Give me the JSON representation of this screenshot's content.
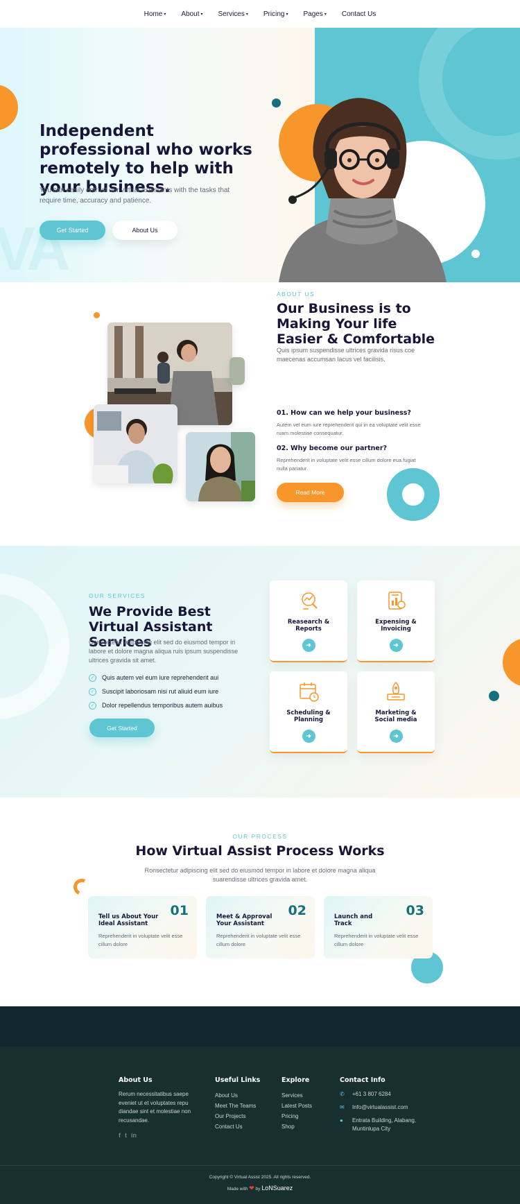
{
  "nav": {
    "items": [
      {
        "label": "Home",
        "dropdown": true
      },
      {
        "label": "About",
        "dropdown": true
      },
      {
        "label": "Services",
        "dropdown": true
      },
      {
        "label": "Pricing",
        "dropdown": true
      },
      {
        "label": "Pages",
        "dropdown": true
      },
      {
        "label": "Contact Us",
        "dropdown": false
      }
    ],
    "caret": "▾"
  },
  "hero": {
    "title": "Independent professional who works remotely to help with your business.",
    "text": "You can easily entrust our virtual assistants with the tasks that require time, accuracy and patience.",
    "primary_button": "Get Started",
    "secondary_button": "About Us"
  },
  "about": {
    "eyebrow": "ABOUT US",
    "title": "Our Business is to Making Your life Easier & Comfortable",
    "text": "Quis ipsum suspendisse ultrices gravida risus coe maecenas accumsan lacus vel facilisis.",
    "q1": "01. How can we help your business?",
    "a1": "Autem vel eum iure reprehenderit qui in ea voluptate velit esse ruam molestiae consequatur.",
    "q2": "02. Why become our partner?",
    "a2": "Reprehenderit in voluptate velit esse cillum dolore eua fugiat nulla pariatur.",
    "button": "Read More"
  },
  "services": {
    "eyebrow": "OUR SERVICES",
    "title": "We Provide Best Virtual Assistant Services",
    "text": "Consectetur adipiscing elit sed do eiusmod tempor in labore et dolore magna aliqua ruis ipsum suspendisse ultrices gravida sit amet.",
    "list": [
      "Quis autem vel eum iure reprehenderit aui",
      "Suscipit laboriosam nisi rut aliuid eum iure",
      "Dolor repellendus temporibus autem auibus"
    ],
    "button": "Get Started",
    "cards": [
      {
        "title": "Reasearch & Reports",
        "icon": "research-icon"
      },
      {
        "title": "Expensing & Invoicing",
        "icon": "invoice-icon"
      },
      {
        "title": "Scheduling & Planning",
        "icon": "calendar-icon"
      },
      {
        "title": "Marketing & Social media",
        "icon": "rocket-icon"
      }
    ]
  },
  "process": {
    "eyebrow": "OUR PROCESS",
    "title": "How Virtual Assist Process Works",
    "text": "Ronsectetur adipiscing elit sed do eiusmod tempor in labore et dolore magna aliqua suarendisse ultrices gravida amet.",
    "steps": [
      {
        "title": "Tell us About Your Ideal Assistant",
        "num": "01",
        "text": "Reprehenderit in voluptate velit esse cillum dolore"
      },
      {
        "title": "Meet & Approval Your Assistant",
        "num": "02",
        "text": "Reprehenderit in voluptate velit esse cillum dolore"
      },
      {
        "title": "Launch and Track",
        "num": "03",
        "text": "Reprehenderit in voluptate velit esse cillum dolore"
      }
    ]
  },
  "footer": {
    "about_head": "About Us",
    "about_text": "Rerum necessitatibus saepe eveniet ut et voluptates repu diandae sint et molestiae non recusandae.",
    "social": [
      "f",
      "t",
      "in"
    ],
    "links_head": "Useful Links",
    "links": [
      "About Us",
      "Meet The Teams",
      "Our Projects",
      "Contact Us"
    ],
    "explore_head": "Explore",
    "explore": [
      "Services",
      "Latest Posts",
      "Pricing",
      "Shop"
    ],
    "contact_head": "Contact Info",
    "phone": "+61 3 807 6284",
    "email": "Info@virtualassist.com",
    "address": "Entrata Building, Alabang, Muntinlupa City",
    "copyright": "Copyright © Virtual Assist 2025. All rights reserved.",
    "made_prefix": "Made with",
    "made_by": "by",
    "brand": "LoNSuarez"
  },
  "colors": {
    "teal": "#5ec6d2",
    "orange": "#f7962a",
    "dark_teal": "#15707e",
    "navy": "#171638",
    "footer_bg": "#17302f"
  }
}
